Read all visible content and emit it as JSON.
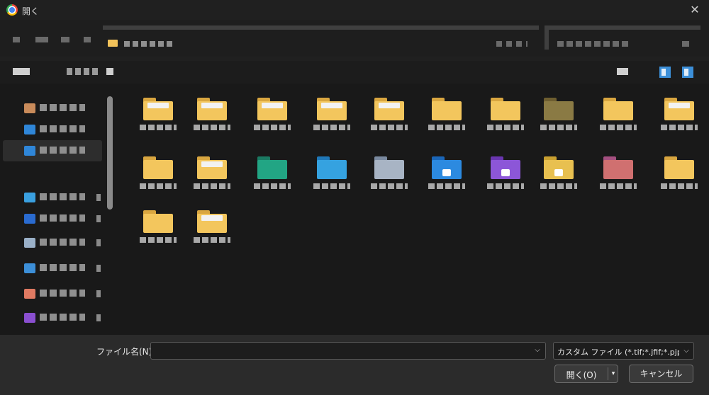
{
  "window": {
    "title": "開く",
    "close_glyph": "✕"
  },
  "footer": {
    "filename_label": "ファイル名(N):",
    "filename_value": "",
    "filter_selected": "カスタム ファイル (*.tif;*.jfif;*.pjp;*.",
    "dropdown_glyph": "⌵",
    "open_label": "開く(O)",
    "open_split_glyph": "▾",
    "cancel_label": "キャンセル"
  },
  "navigation": {
    "items": [
      {
        "icon": "user-folder-icon",
        "color": "#c98b5a"
      },
      {
        "icon": "cloud-drive-icon",
        "color": "#2f86d8"
      },
      {
        "icon": "cloud-drive-icon",
        "color": "#2f86d8"
      },
      {
        "icon": "desktop-icon",
        "color": "#3aa0e0"
      },
      {
        "icon": "downloads-icon",
        "color": "#2a6bd0"
      },
      {
        "icon": "documents-icon",
        "color": "#9ab0c8"
      },
      {
        "icon": "pictures-icon",
        "color": "#3c8fd8"
      },
      {
        "icon": "music-icon",
        "color": "#e07a62"
      },
      {
        "icon": "videos-icon",
        "color": "#8a4fd0"
      }
    ]
  },
  "folders": [
    {
      "icon": "folder-icon",
      "tab": "#d9a640",
      "color": "#f3c65d",
      "paper": true
    },
    {
      "icon": "folder-icon",
      "tab": "#d9a640",
      "color": "#f3c65d",
      "paper": true
    },
    {
      "icon": "folder-icon",
      "tab": "#d9a640",
      "color": "#f3c65d",
      "paper": true
    },
    {
      "icon": "folder-icon",
      "tab": "#d9a640",
      "color": "#f3c65d",
      "paper": true
    },
    {
      "icon": "folder-icon",
      "tab": "#d9a640",
      "color": "#f3c65d",
      "paper": true
    },
    {
      "icon": "folder-icon",
      "tab": "#d9a640",
      "color": "#f3c65d",
      "paper": false
    },
    {
      "icon": "folder-icon",
      "tab": "#d9a640",
      "color": "#f3c65d",
      "paper": false
    },
    {
      "icon": "folder-icon",
      "tab": "#6e5e30",
      "color": "#8a7a44",
      "paper": false
    },
    {
      "icon": "folder-icon",
      "tab": "#d9a640",
      "color": "#f3c65d",
      "paper": false
    },
    {
      "icon": "folder-icon",
      "tab": "#d9a640",
      "color": "#f3c65d",
      "paper": true
    },
    {
      "icon": "folder-icon",
      "tab": "#d9a640",
      "color": "#f3c65d",
      "paper": false
    },
    {
      "icon": "folder-icon",
      "tab": "#d9a640",
      "color": "#f3c65d",
      "paper": true
    },
    {
      "icon": "green-folder-icon",
      "tab": "#1a7a62",
      "color": "#22a584",
      "paper": false
    },
    {
      "icon": "blue-folder-icon",
      "tab": "#1f78b8",
      "color": "#35a2e0",
      "paper": false
    },
    {
      "icon": "gray-folder-icon",
      "tab": "#7a8aa0",
      "color": "#a8b4c4",
      "paper": false
    },
    {
      "icon": "cloud-folder-icon",
      "tab": "#1a66b8",
      "color": "#2c8ae0",
      "paper": false,
      "badge": true
    },
    {
      "icon": "purple-folder-icon",
      "tab": "#6a36b0",
      "color": "#8c56d8",
      "paper": false,
      "badge": true
    },
    {
      "icon": "google-drive-folder-icon",
      "tab": "#c9a030",
      "color": "#e8c050",
      "paper": false,
      "badge": true
    },
    {
      "icon": "pink-folder-icon",
      "tab": "#a55080",
      "color": "#d07070",
      "paper": false
    },
    {
      "icon": "folder-icon",
      "tab": "#d9a640",
      "color": "#f3c65d",
      "paper": false
    },
    {
      "icon": "folder-icon",
      "tab": "#d9a640",
      "color": "#f3c65d",
      "paper": false
    },
    {
      "icon": "folder-icon",
      "tab": "#d9a640",
      "color": "#f3c65d",
      "paper": true
    }
  ]
}
